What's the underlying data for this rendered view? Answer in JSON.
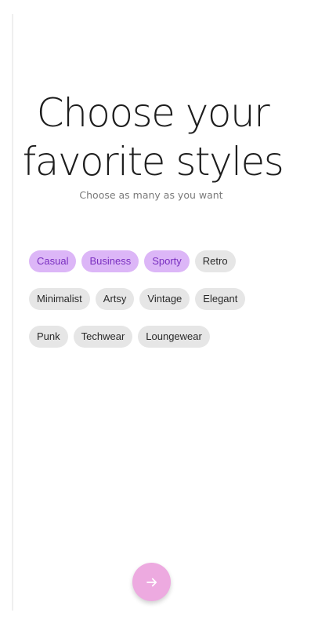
{
  "header": {
    "title_line1": "Choose your",
    "title_line2": "favorite styles",
    "subtitle": "Choose as many as you want"
  },
  "styles": {
    "rows": [
      [
        {
          "label": "Casual",
          "selected": true
        },
        {
          "label": "Business",
          "selected": true
        },
        {
          "label": "Sporty",
          "selected": true
        },
        {
          "label": "Retro",
          "selected": false
        }
      ],
      [
        {
          "label": "Minimalist",
          "selected": false
        },
        {
          "label": "Artsy",
          "selected": false
        },
        {
          "label": "Vintage",
          "selected": false
        },
        {
          "label": "Elegant",
          "selected": false
        }
      ],
      [
        {
          "label": "Punk",
          "selected": false
        },
        {
          "label": "Techwear",
          "selected": false
        },
        {
          "label": "Loungewear",
          "selected": false
        }
      ]
    ]
  },
  "next_button": {
    "icon": "arrow-right-icon"
  },
  "colors": {
    "selected_chip_bg": "#dcb6f7",
    "selected_chip_text": "#7a2fc0",
    "chip_bg": "#e6e6e6",
    "next_button_bg": "#edaae0"
  }
}
